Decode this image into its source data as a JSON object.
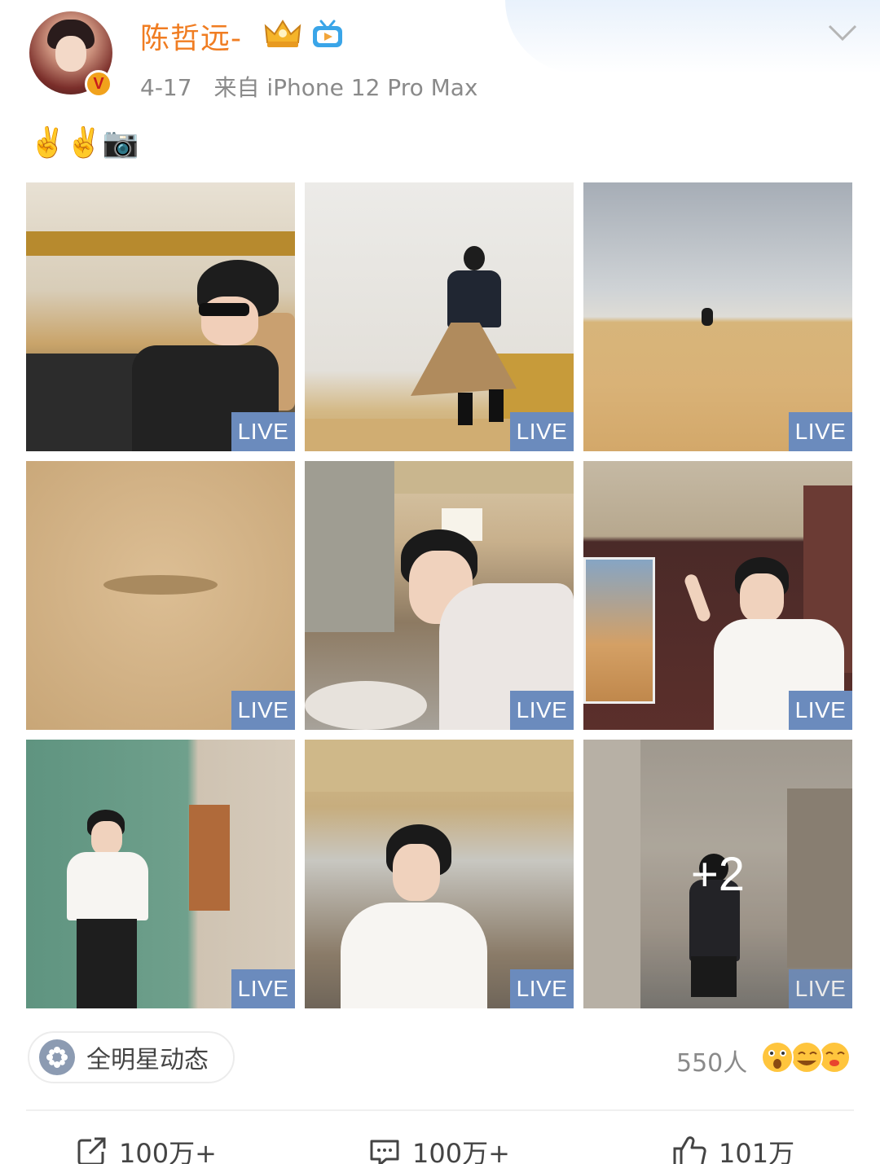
{
  "post": {
    "author": "陈哲远-",
    "date": "4-17",
    "source": "来自 iPhone 12 Pro Max",
    "content": "✌️✌️📷",
    "verified_mark": "V"
  },
  "images": [
    {
      "caption": "jeep-driver",
      "badge": "LIVE"
    },
    {
      "caption": "standing-on-jeep",
      "badge": "LIVE"
    },
    {
      "caption": "desert-dunes",
      "badge": "LIVE"
    },
    {
      "caption": "sand-closeup",
      "badge": "LIVE"
    },
    {
      "caption": "market-lean",
      "badge": "LIVE"
    },
    {
      "caption": "carpet-peace-sign",
      "badge": "LIVE"
    },
    {
      "caption": "green-carpet-standing",
      "badge": "LIVE"
    },
    {
      "caption": "market-walk",
      "badge": "LIVE"
    },
    {
      "caption": "alley-walk",
      "badge": "LIVE",
      "more": "+2"
    }
  ],
  "footer": {
    "topic": "全明星动态",
    "reaction_count": "550人",
    "repost_count": "100万+",
    "comment_count": "100万+",
    "like_count": "101万"
  },
  "colors": {
    "name": "#f07d22",
    "live_badge": "#6b8bbd",
    "meta_text": "#8a8a8a"
  }
}
